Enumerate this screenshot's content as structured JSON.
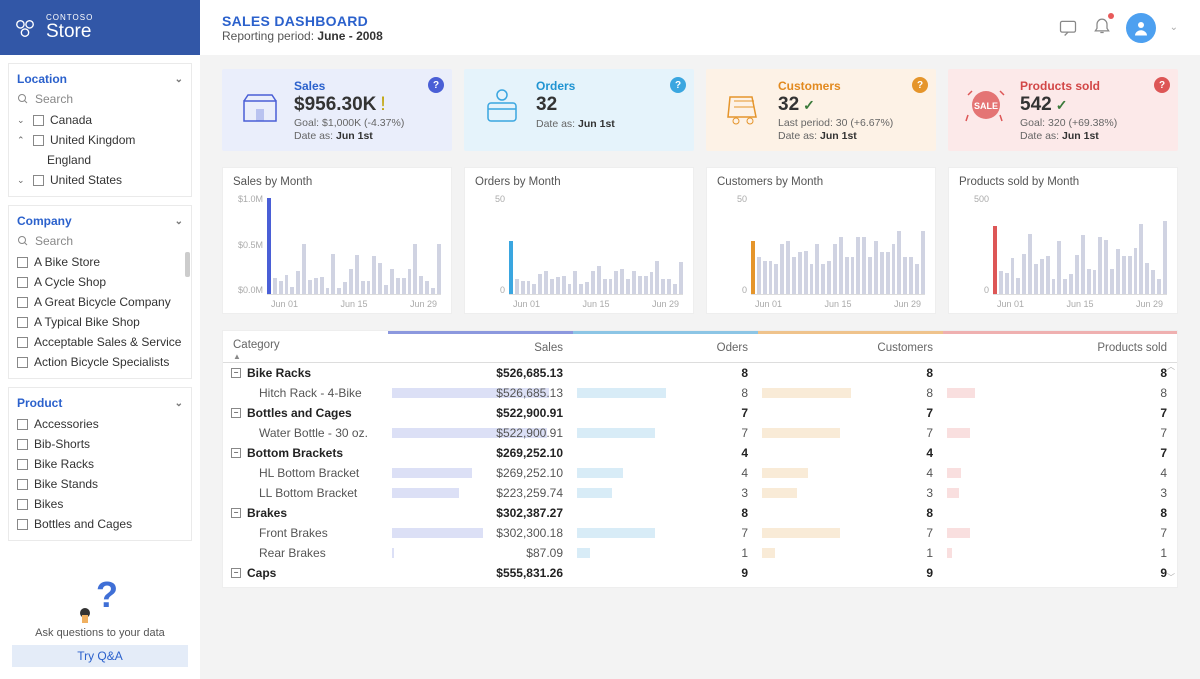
{
  "logo": {
    "sup": "CONTOSO",
    "main": "Store"
  },
  "header": {
    "title": "SALES DASHBOARD",
    "subtitle_prefix": "Reporting period: ",
    "subtitle_bold": "June - 2008"
  },
  "filters": {
    "location": {
      "title": "Location",
      "search_placeholder": "Search",
      "items": [
        {
          "expand": "down",
          "label": "Canada"
        },
        {
          "expand": "up",
          "label": "United Kingdom"
        },
        {
          "child": "England"
        },
        {
          "expand": "down",
          "label": "United States"
        }
      ]
    },
    "company": {
      "title": "Company",
      "search_placeholder": "Search",
      "items": [
        "A Bike Store",
        "A Cycle Shop",
        "A Great Bicycle Company",
        "A Typical Bike Shop",
        "Acceptable Sales & Service",
        "Action Bicycle Specialists"
      ]
    },
    "product": {
      "title": "Product",
      "items": [
        "Accessories",
        "Bib-Shorts",
        "Bike Racks",
        "Bike Stands",
        "Bikes",
        "Bottles and Cages"
      ]
    }
  },
  "qa": {
    "text": "Ask questions to your data",
    "button": "Try Q&A"
  },
  "cards": {
    "sales": {
      "label": "Sales",
      "value": "$956.30K",
      "goal": "Goal: $1,000K (-4.37%)",
      "date": "Jun 1st",
      "date_prefix": "Date as: ",
      "indicator": "warn"
    },
    "orders": {
      "label": "Orders",
      "value": "32",
      "goal": "",
      "date": "Jun 1st",
      "date_prefix": "Date as: ",
      "indicator": ""
    },
    "customers": {
      "label": "Customers",
      "value": "32",
      "goal": "Last period: 30 (+6.67%)",
      "date": "Jun 1st",
      "date_prefix": "Date as: ",
      "indicator": "check"
    },
    "products": {
      "label": "Products sold",
      "value": "542",
      "goal": "Goal: 320 (+69.38%)",
      "date": "Jun 1st",
      "date_prefix": "Date as: ",
      "indicator": "check"
    }
  },
  "charts": {
    "sales": {
      "title": "Sales by Month",
      "yticks": [
        "$1.0M",
        "$0.5M",
        "$0.0M"
      ]
    },
    "orders": {
      "title": "Orders by Month",
      "yticks": [
        "50",
        "0"
      ]
    },
    "customers": {
      "title": "Customers by Month",
      "yticks": [
        "50",
        "0"
      ]
    },
    "products": {
      "title": "Products sold by Month",
      "yticks": [
        "500",
        "0"
      ]
    },
    "xticks": [
      "Jun 01",
      "Jun 15",
      "Jun 29"
    ]
  },
  "chart_data": [
    {
      "type": "bar",
      "title": "Sales by Month",
      "ylabel": "",
      "xlabel": "",
      "ylim": [
        0,
        1000000
      ],
      "categories": [
        "Jun 01",
        "Jun 02",
        "Jun 03",
        "Jun 04",
        "Jun 05",
        "Jun 06",
        "Jun 07",
        "Jun 08",
        "Jun 09",
        "Jun 10",
        "Jun 11",
        "Jun 12",
        "Jun 13",
        "Jun 14",
        "Jun 15",
        "Jun 16",
        "Jun 17",
        "Jun 18",
        "Jun 19",
        "Jun 20",
        "Jun 21",
        "Jun 22",
        "Jun 23",
        "Jun 24",
        "Jun 25",
        "Jun 26",
        "Jun 27",
        "Jun 28",
        "Jun 29",
        "Jun 30"
      ],
      "values": [
        956300,
        160000,
        130000,
        190000,
        70000,
        230000,
        500000,
        140000,
        160000,
        170000,
        60000,
        400000,
        60000,
        120000,
        250000,
        390000,
        130000,
        130000,
        380000,
        310000,
        90000,
        250000,
        160000,
        160000,
        250000,
        500000,
        180000,
        130000,
        60000,
        500000
      ],
      "highlight_index": 0
    },
    {
      "type": "bar",
      "title": "Orders by Month",
      "ylabel": "",
      "xlabel": "",
      "ylim": [
        0,
        60
      ],
      "categories": [
        "Jun 01",
        "Jun 02",
        "Jun 03",
        "Jun 04",
        "Jun 05",
        "Jun 06",
        "Jun 07",
        "Jun 08",
        "Jun 09",
        "Jun 10",
        "Jun 11",
        "Jun 12",
        "Jun 13",
        "Jun 14",
        "Jun 15",
        "Jun 16",
        "Jun 17",
        "Jun 18",
        "Jun 19",
        "Jun 20",
        "Jun 21",
        "Jun 22",
        "Jun 23",
        "Jun 24",
        "Jun 25",
        "Jun 26",
        "Jun 27",
        "Jun 28",
        "Jun 29",
        "Jun 30"
      ],
      "values": [
        32,
        9,
        8,
        8,
        6,
        12,
        14,
        9,
        10,
        11,
        6,
        14,
        6,
        7,
        14,
        17,
        9,
        9,
        14,
        15,
        9,
        14,
        11,
        11,
        13,
        20,
        9,
        9,
        6,
        19
      ],
      "highlight_index": 0
    },
    {
      "type": "bar",
      "title": "Customers by Month",
      "ylabel": "",
      "xlabel": "",
      "ylim": [
        0,
        60
      ],
      "categories": [
        "Jun 01",
        "Jun 02",
        "Jun 03",
        "Jun 04",
        "Jun 05",
        "Jun 06",
        "Jun 07",
        "Jun 08",
        "Jun 09",
        "Jun 10",
        "Jun 11",
        "Jun 12",
        "Jun 13",
        "Jun 14",
        "Jun 15",
        "Jun 16",
        "Jun 17",
        "Jun 18",
        "Jun 19",
        "Jun 20",
        "Jun 21",
        "Jun 22",
        "Jun 23",
        "Jun 24",
        "Jun 25",
        "Jun 26",
        "Jun 27",
        "Jun 28",
        "Jun 29",
        "Jun 30"
      ],
      "values": [
        32,
        22,
        20,
        20,
        18,
        30,
        32,
        22,
        25,
        26,
        18,
        30,
        18,
        20,
        30,
        34,
        22,
        22,
        34,
        34,
        22,
        32,
        25,
        25,
        30,
        38,
        22,
        22,
        18,
        38
      ],
      "highlight_index": 0
    },
    {
      "type": "bar",
      "title": "Products sold by Month",
      "ylabel": "",
      "xlabel": "",
      "ylim": [
        0,
        800
      ],
      "categories": [
        "Jun 01",
        "Jun 02",
        "Jun 03",
        "Jun 04",
        "Jun 05",
        "Jun 06",
        "Jun 07",
        "Jun 08",
        "Jun 09",
        "Jun 10",
        "Jun 11",
        "Jun 12",
        "Jun 13",
        "Jun 14",
        "Jun 15",
        "Jun 16",
        "Jun 17",
        "Jun 18",
        "Jun 19",
        "Jun 20",
        "Jun 21",
        "Jun 22",
        "Jun 23",
        "Jun 24",
        "Jun 25",
        "Jun 26",
        "Jun 27",
        "Jun 28",
        "Jun 29",
        "Jun 30"
      ],
      "values": [
        542,
        180,
        170,
        290,
        130,
        320,
        480,
        240,
        280,
        300,
        120,
        420,
        120,
        160,
        310,
        470,
        200,
        190,
        460,
        430,
        200,
        360,
        300,
        300,
        370,
        560,
        250,
        190,
        120,
        580
      ],
      "highlight_index": 0
    }
  ],
  "table": {
    "columns": {
      "category": "Category",
      "sales": "Sales",
      "orders": "Oders",
      "customers": "Customers",
      "products": "Products sold"
    },
    "rows": [
      {
        "type": "group",
        "cat": "Bike Racks",
        "sales": "$526,685.13",
        "o": "8",
        "c": "8",
        "p": "8"
      },
      {
        "type": "item",
        "cat": "Hitch Rack - 4-Bike",
        "sales": "$526,685.13",
        "o": "8",
        "c": "8",
        "p": "8",
        "bars": {
          "s": 85,
          "o": 48,
          "c": 48,
          "p": 12
        }
      },
      {
        "type": "group",
        "cat": "Bottles and Cages",
        "sales": "$522,900.91",
        "o": "7",
        "c": "7",
        "p": "7"
      },
      {
        "type": "item",
        "cat": "Water Bottle - 30 oz.",
        "sales": "$522,900.91",
        "o": "7",
        "c": "7",
        "p": "7",
        "bars": {
          "s": 84,
          "o": 42,
          "c": 42,
          "p": 10
        }
      },
      {
        "type": "group",
        "cat": "Bottom Brackets",
        "sales": "$269,252.10",
        "o": "4",
        "c": "4",
        "p": "7"
      },
      {
        "type": "item",
        "cat": "HL Bottom Bracket",
        "sales": "$269,252.10",
        "o": "4",
        "c": "4",
        "p": "4",
        "bars": {
          "s": 43,
          "o": 25,
          "c": 25,
          "p": 6
        }
      },
      {
        "type": "item",
        "cat": "LL Bottom Bracket",
        "sales": "$223,259.74",
        "o": "3",
        "c": "3",
        "p": "3",
        "bars": {
          "s": 36,
          "o": 19,
          "c": 19,
          "p": 5
        }
      },
      {
        "type": "group",
        "cat": "Brakes",
        "sales": "$302,387.27",
        "o": "8",
        "c": "8",
        "p": "8"
      },
      {
        "type": "item",
        "cat": "Front Brakes",
        "sales": "$302,300.18",
        "o": "7",
        "c": "7",
        "p": "7",
        "bars": {
          "s": 49,
          "o": 42,
          "c": 42,
          "p": 10
        }
      },
      {
        "type": "item",
        "cat": "Rear Brakes",
        "sales": "$87.09",
        "o": "1",
        "c": "1",
        "p": "1",
        "bars": {
          "s": 1,
          "o": 7,
          "c": 7,
          "p": 2
        }
      },
      {
        "type": "group",
        "cat": "Caps",
        "sales": "$555,831.26",
        "o": "9",
        "c": "9",
        "p": "9"
      }
    ]
  }
}
